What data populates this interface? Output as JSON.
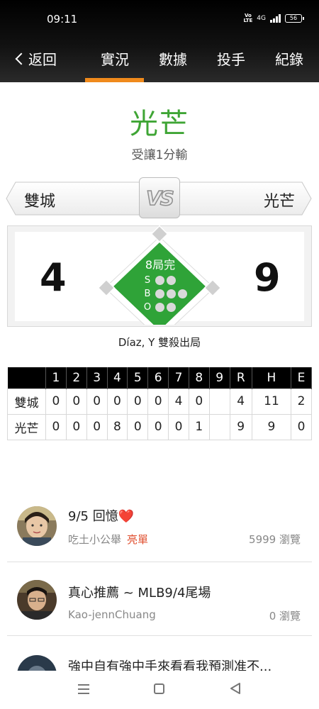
{
  "status_bar": {
    "time": "09:11",
    "volte_top": "Vo",
    "volte_bottom": "LTE",
    "network": "4G",
    "battery": "56"
  },
  "header": {
    "back_label": "返回",
    "tabs": [
      {
        "label": "實況",
        "active": true
      },
      {
        "label": "數據",
        "active": false
      },
      {
        "label": "投手",
        "active": false
      },
      {
        "label": "紀錄",
        "active": false
      }
    ],
    "accent_color": "#f08a1c"
  },
  "result": {
    "winner": "光芒",
    "description": "受讓1分輸",
    "winner_color": "#3fa535"
  },
  "matchup": {
    "away_team": "雙城",
    "home_team": "光芒",
    "vs_label": "VS"
  },
  "scoreboard": {
    "away_score": "4",
    "home_score": "9",
    "inning_status": "8局完",
    "count_labels": {
      "s": "S",
      "b": "B",
      "o": "O"
    },
    "last_play": "Díaz, Y 雙殺出局"
  },
  "linescore": {
    "headers": [
      "1",
      "2",
      "3",
      "4",
      "5",
      "6",
      "7",
      "8",
      "9",
      "R",
      "H",
      "E"
    ],
    "rows": [
      {
        "team": "雙城",
        "innings": [
          "0",
          "0",
          "0",
          "0",
          "0",
          "0",
          "4",
          "0",
          ""
        ],
        "r": "4",
        "h": "11",
        "e": "2"
      },
      {
        "team": "光芒",
        "innings": [
          "0",
          "0",
          "0",
          "8",
          "0",
          "0",
          "0",
          "1",
          ""
        ],
        "r": "9",
        "h": "9",
        "e": "0"
      }
    ]
  },
  "posts": [
    {
      "title": "9/5 回憶",
      "emoji": "❤️",
      "author": "吃土小公舉",
      "tag": "亮單",
      "views": "5999 瀏覽"
    },
    {
      "title": "真心推薦 ~ MLB9/4尾場",
      "author": "Kao-jennChuang",
      "views": "0 瀏覽"
    },
    {
      "title": "強中自有強中手來看看我預測准不..."
    }
  ]
}
